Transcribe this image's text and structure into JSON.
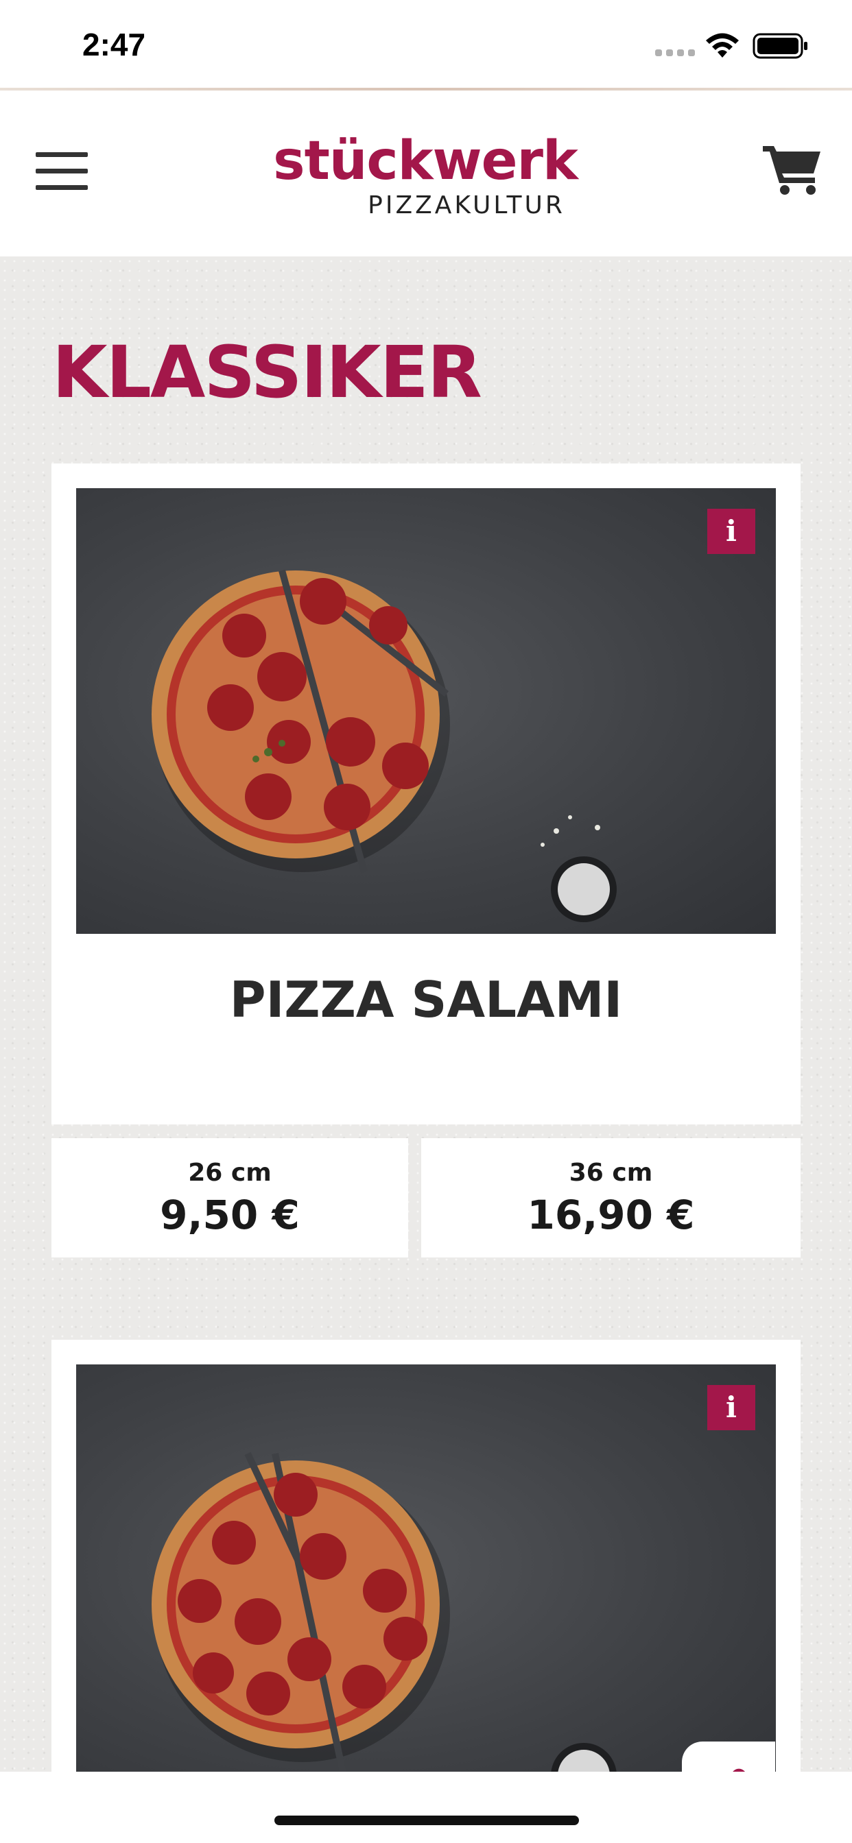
{
  "status_bar": {
    "time": "2:47"
  },
  "header": {
    "logo_main": "stückwerk",
    "logo_sub": "PIZZAKULTUR"
  },
  "section": {
    "title": "KLASSIKER"
  },
  "products": [
    {
      "name": "PIZZA SALAMI",
      "info_label": "i",
      "prices": [
        {
          "size": "26 cm",
          "price": "9,50 €"
        },
        {
          "size": "36 cm",
          "price": "16,90 €"
        }
      ]
    },
    {
      "name": "",
      "info_label": "i"
    }
  ],
  "colors": {
    "brand": "#a3174a",
    "background": "#ebeae8",
    "card": "#ffffff",
    "text_dark": "#2b2b2b"
  },
  "icons": [
    "menu-icon",
    "cart-icon",
    "info-icon",
    "wifi-icon",
    "battery-icon"
  ]
}
